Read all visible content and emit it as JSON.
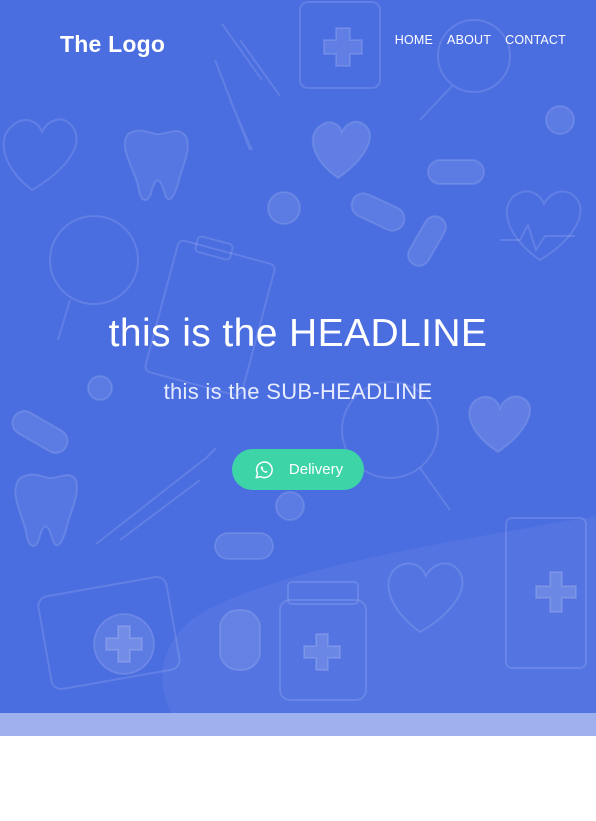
{
  "header": {
    "logo": "The Logo",
    "nav": [
      "HOME",
      "ABOUT",
      "CONTACT"
    ]
  },
  "hero": {
    "headline": "this is the HEADLINE",
    "subheadline": "this is the SUB-HEADLINE",
    "cta": {
      "label": "Delivery",
      "icon": "whatsapp-icon"
    }
  },
  "colors": {
    "hero_background": "#4a6de0",
    "cta_background": "#3dd4a7",
    "bottom_strip": "#9fb0ee",
    "page_background": "#ffffff"
  }
}
